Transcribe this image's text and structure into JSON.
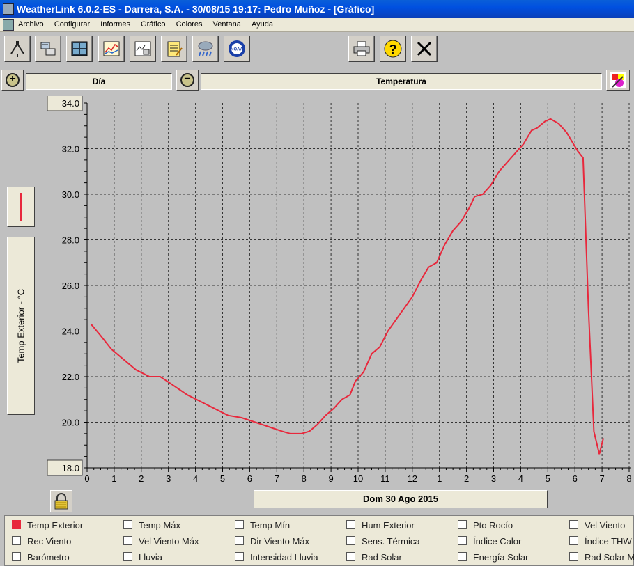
{
  "window": {
    "title": "WeatherLink 6.0.2-ES  -  Darrera, S.A.  -  30/08/15  19:17: Pedro Muñoz - [Gráfico]"
  },
  "menu": [
    "Archivo",
    "Configurar",
    "Informes",
    "Gráfico",
    "Colores",
    "Ventana",
    "Ayuda"
  ],
  "toolbar": {
    "icons": [
      "station-icon",
      "console-icon",
      "bulletin-icon",
      "chart-icon",
      "strip-chart-icon",
      "notes-icon",
      "rain-icon",
      "noaa-icon",
      "printer-icon",
      "help-icon",
      "close-icon"
    ],
    "noaa_label": "NOAA"
  },
  "zoom": {
    "period": "Día",
    "variable": "Temperatura"
  },
  "ylabel": "Temp Exterior - °C",
  "date_label": "Dom 30 Ago 2015",
  "legend": [
    {
      "label": "Temp Exterior",
      "checked": true
    },
    {
      "label": "Temp Máx",
      "checked": false
    },
    {
      "label": "Temp Mín",
      "checked": false
    },
    {
      "label": "Hum Exterior",
      "checked": false
    },
    {
      "label": "Pto Rocío",
      "checked": false
    },
    {
      "label": "Vel Viento",
      "checked": false
    },
    {
      "label": "Rec Viento",
      "checked": false
    },
    {
      "label": "Vel Viento Máx",
      "checked": false
    },
    {
      "label": "Dir Viento Máx",
      "checked": false
    },
    {
      "label": "Sens. Térmica",
      "checked": false
    },
    {
      "label": "Índice Calor",
      "checked": false
    },
    {
      "label": "Índice THW",
      "checked": false
    },
    {
      "label": "Barómetro",
      "checked": false
    },
    {
      "label": "Lluvia",
      "checked": false
    },
    {
      "label": "Intensidad Lluvia",
      "checked": false
    },
    {
      "label": "Rad Solar",
      "checked": false
    },
    {
      "label": "Energía Solar",
      "checked": false
    },
    {
      "label": "Rad Solar Máx",
      "checked": false
    }
  ],
  "chart_data": {
    "type": "line",
    "series_color": "#e8283c",
    "grid": true,
    "ylim": [
      18.0,
      34.0
    ],
    "yticks": [
      "34.0",
      "32.0",
      "30.0",
      "28.0",
      "26.0",
      "24.0",
      "22.0",
      "20.0",
      "18.0"
    ],
    "xticks": [
      "0",
      "1",
      "2",
      "3",
      "4",
      "5",
      "6",
      "7",
      "8",
      "9",
      "10",
      "11",
      "12",
      "1",
      "2",
      "3",
      "4",
      "5",
      "6",
      "7",
      "8"
    ],
    "series": [
      {
        "x": [
          0.15,
          0.5,
          0.9,
          1.3,
          1.8,
          2.3,
          2.7,
          3.2,
          3.7,
          4.2,
          4.7,
          5.2,
          5.7,
          6.2,
          6.7,
          7.2,
          7.5,
          7.9,
          8.2,
          8.5,
          8.8,
          9.1,
          9.4,
          9.7,
          9.9,
          10.2,
          10.5,
          10.8,
          11.1,
          11.4,
          11.7,
          12.0,
          12.3,
          12.6,
          12.9,
          13.2,
          13.5,
          13.8,
          14.1,
          14.3,
          14.6,
          14.9,
          15.2,
          15.5,
          15.8,
          16.1,
          16.4,
          16.6,
          16.9,
          17.1,
          17.4,
          17.7,
          17.9,
          18.1,
          18.3,
          18.5,
          18.7,
          18.9,
          19.05
        ],
        "y": [
          24.3,
          23.8,
          23.2,
          22.8,
          22.3,
          22.0,
          22.0,
          21.6,
          21.2,
          20.9,
          20.6,
          20.3,
          20.2,
          20.0,
          19.8,
          19.6,
          19.5,
          19.5,
          19.6,
          19.9,
          20.3,
          20.6,
          21.0,
          21.2,
          21.8,
          22.2,
          23.0,
          23.3,
          24.0,
          24.5,
          25.0,
          25.5,
          26.2,
          26.8,
          27.0,
          27.8,
          28.4,
          28.8,
          29.4,
          29.9,
          30.0,
          30.4,
          31.0,
          31.4,
          31.8,
          32.2,
          32.8,
          32.9,
          33.2,
          33.3,
          33.1,
          32.7,
          32.3,
          31.9,
          31.6,
          25.0,
          19.6,
          18.6,
          19.3
        ]
      }
    ]
  }
}
